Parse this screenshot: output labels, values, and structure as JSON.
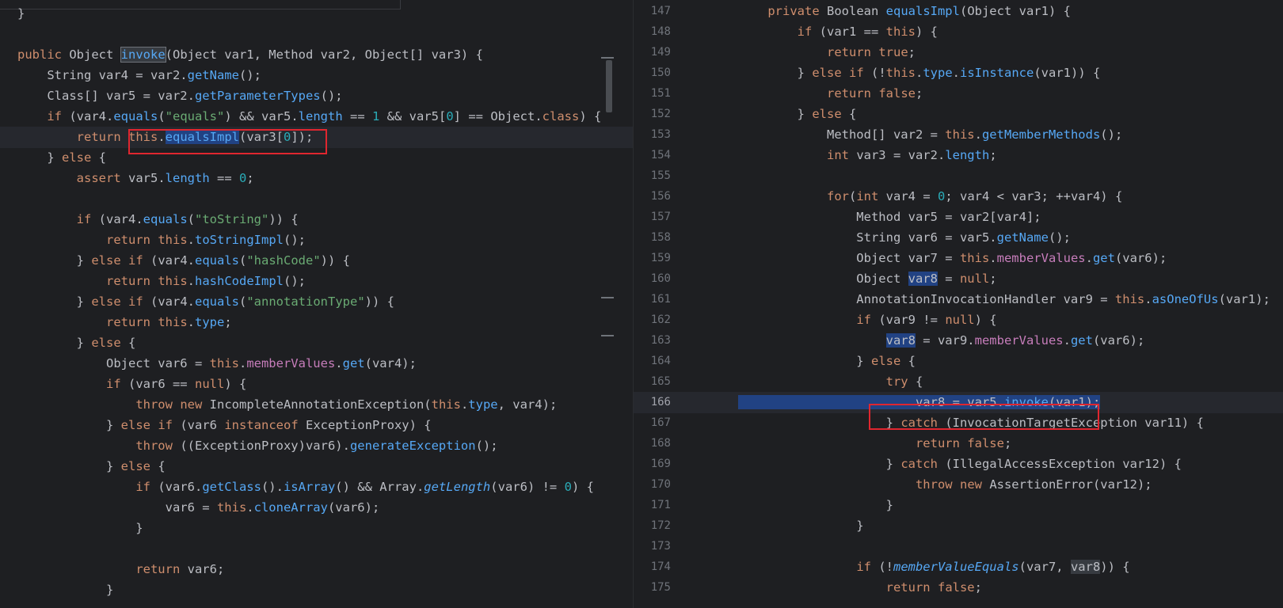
{
  "left": {
    "lines": [
      {
        "code": "}"
      },
      {
        "code": ""
      },
      {
        "code": "public Object invoke(Object var1, Method var2, Object[] var3) {"
      },
      {
        "code": "    String var4 = var2.getName();"
      },
      {
        "code": "    Class[] var5 = var2.getParameterTypes();"
      },
      {
        "code": "    if (var4.equals(\"equals\") && var5.length == 1 && var5[0] == Object.class) {"
      },
      {
        "code": "        return this.equalsImpl(var3[0]);"
      },
      {
        "code": "    } else {"
      },
      {
        "code": "        assert var5.length == 0;"
      },
      {
        "code": ""
      },
      {
        "code": "        if (var4.equals(\"toString\")) {"
      },
      {
        "code": "            return this.toStringImpl();"
      },
      {
        "code": "        } else if (var4.equals(\"hashCode\")) {"
      },
      {
        "code": "            return this.hashCodeImpl();"
      },
      {
        "code": "        } else if (var4.equals(\"annotationType\")) {"
      },
      {
        "code": "            return this.type;"
      },
      {
        "code": "        } else {"
      },
      {
        "code": "            Object var6 = this.memberValues.get(var4);"
      },
      {
        "code": "            if (var6 == null) {"
      },
      {
        "code": "                throw new IncompleteAnnotationException(this.type, var4);"
      },
      {
        "code": "            } else if (var6 instanceof ExceptionProxy) {"
      },
      {
        "code": "                throw ((ExceptionProxy)var6).generateException();"
      },
      {
        "code": "            } else {"
      },
      {
        "code": "                if (var6.getClass().isArray() && Array.getLength(var6) != 0) {"
      },
      {
        "code": "                    var6 = this.cloneArray(var6);"
      },
      {
        "code": "                }"
      },
      {
        "code": ""
      },
      {
        "code": "                return var6;"
      },
      {
        "code": "            }"
      }
    ]
  },
  "right": {
    "lines": [
      {
        "num": "147",
        "code": "    private Boolean equalsImpl(Object var1) {"
      },
      {
        "num": "148",
        "code": "        if (var1 == this) {"
      },
      {
        "num": "149",
        "code": "            return true;"
      },
      {
        "num": "150",
        "code": "        } else if (!this.type.isInstance(var1)) {"
      },
      {
        "num": "151",
        "code": "            return false;"
      },
      {
        "num": "152",
        "code": "        } else {"
      },
      {
        "num": "153",
        "code": "            Method[] var2 = this.getMemberMethods();"
      },
      {
        "num": "154",
        "code": "            int var3 = var2.length;"
      },
      {
        "num": "155",
        "code": ""
      },
      {
        "num": "156",
        "code": "            for(int var4 = 0; var4 < var3; ++var4) {"
      },
      {
        "num": "157",
        "code": "                Method var5 = var2[var4];"
      },
      {
        "num": "158",
        "code": "                String var6 = var5.getName();"
      },
      {
        "num": "159",
        "code": "                Object var7 = this.memberValues.get(var6);"
      },
      {
        "num": "160",
        "code": "                Object var8 = null;"
      },
      {
        "num": "161",
        "code": "                AnnotationInvocationHandler var9 = this.asOneOfUs(var1);"
      },
      {
        "num": "162",
        "code": "                if (var9 != null) {"
      },
      {
        "num": "163",
        "code": "                    var8 = var9.memberValues.get(var6);"
      },
      {
        "num": "164",
        "code": "                } else {"
      },
      {
        "num": "165",
        "code": "                    try {"
      },
      {
        "num": "166",
        "code": "                        var8 = var5.invoke(var1);"
      },
      {
        "num": "167",
        "code": "                    } catch (InvocationTargetException var11) {"
      },
      {
        "num": "168",
        "code": "                        return false;"
      },
      {
        "num": "169",
        "code": "                    } catch (IllegalAccessException var12) {"
      },
      {
        "num": "170",
        "code": "                        throw new AssertionError(var12);"
      },
      {
        "num": "171",
        "code": "                    }"
      },
      {
        "num": "172",
        "code": "                }"
      },
      {
        "num": "173",
        "code": ""
      },
      {
        "num": "174",
        "code": "                if (!memberValueEquals(var7, var8)) {"
      },
      {
        "num": "175",
        "code": "                    return false;"
      }
    ]
  },
  "colors": {
    "background": "#1e1f22",
    "keyword": "#cf8e6d",
    "string": "#6aab73",
    "number": "#2aacb8",
    "method": "#56a8f5",
    "field": "#c77dbb",
    "selection": "#214283",
    "annotation_box": "#e0262f"
  }
}
